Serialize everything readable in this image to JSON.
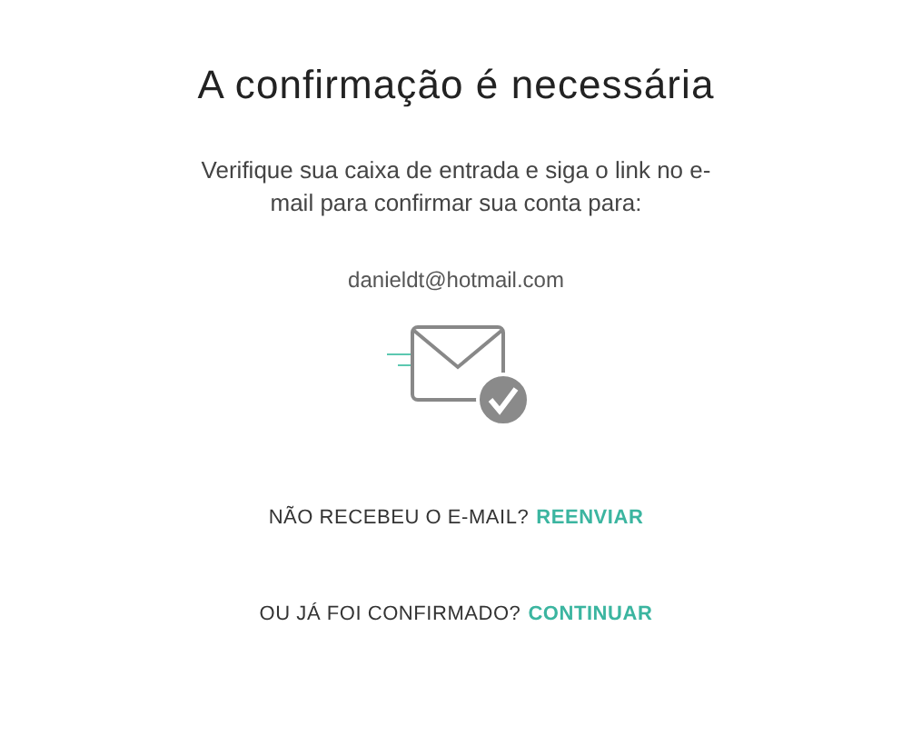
{
  "title": "A confirmação é necessária",
  "message": "Verifique sua caixa de entrada e siga o link no e-mail para confirmar sua conta para:",
  "email": "danieldt@hotmail.com",
  "prompts": [
    {
      "question": "NÃO RECEBEU O E-MAIL?",
      "link": "REENVIAR"
    },
    {
      "question": "OU JÁ FOI CONFIRMADO?",
      "link": "CONTINUAR"
    }
  ]
}
